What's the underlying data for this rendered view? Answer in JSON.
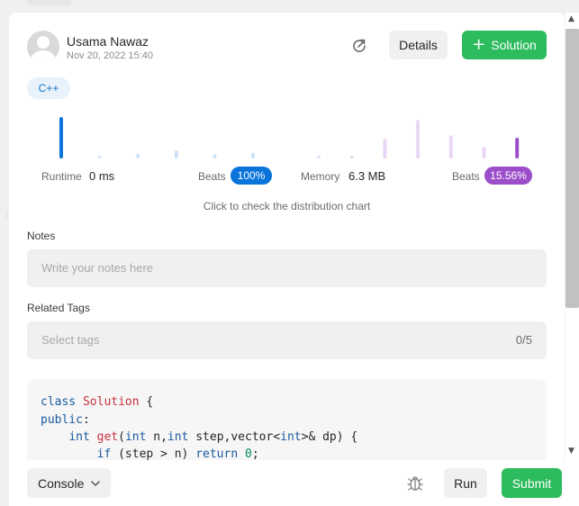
{
  "post": {
    "author": "Usama Nawaz",
    "date": "Nov 20, 2022 15:40",
    "language": "C++"
  },
  "header": {
    "refresh_icon": "refresh-icon",
    "details_label": "Details",
    "solution_label": "Solution",
    "solution_icon": "plus-icon"
  },
  "stats": {
    "runtime_label": "Runtime",
    "runtime_value": "0 ms",
    "runtime_beats_label": "Beats",
    "runtime_beats": "100%",
    "memory_label": "Memory",
    "memory_value": "6.3 MB",
    "memory_beats_label": "Beats",
    "memory_beats": "15.56%",
    "hint": "Click to check the distribution chart",
    "runtime_color": "#0a74da",
    "memory_color": "#9b4dca"
  },
  "chart_data": [
    {
      "type": "bar",
      "series": [
        {
          "values": [
            1.0,
            0.06,
            0.12,
            0.2,
            0.1,
            0.14
          ],
          "highlight_index": 0
        }
      ]
    },
    {
      "type": "bar",
      "series": [
        {
          "values": [
            0.05,
            0.05,
            0.47,
            0.93,
            0.56,
            0.28,
            0.5
          ],
          "highlight_index": 6
        }
      ]
    }
  ],
  "notes": {
    "label": "Notes",
    "placeholder": "Write your notes here"
  },
  "tags": {
    "label": "Related Tags",
    "placeholder": "Select tags",
    "count": "0/5"
  },
  "code": {
    "lines": [
      "class Solution {",
      "public:",
      "    int get(int n,int step,vector<int>& dp) {",
      "        if (step > n) return 0;"
    ]
  },
  "footer": {
    "console_label": "Console",
    "bug_icon": "bug-icon",
    "run_label": "Run",
    "submit_label": "Submit"
  }
}
